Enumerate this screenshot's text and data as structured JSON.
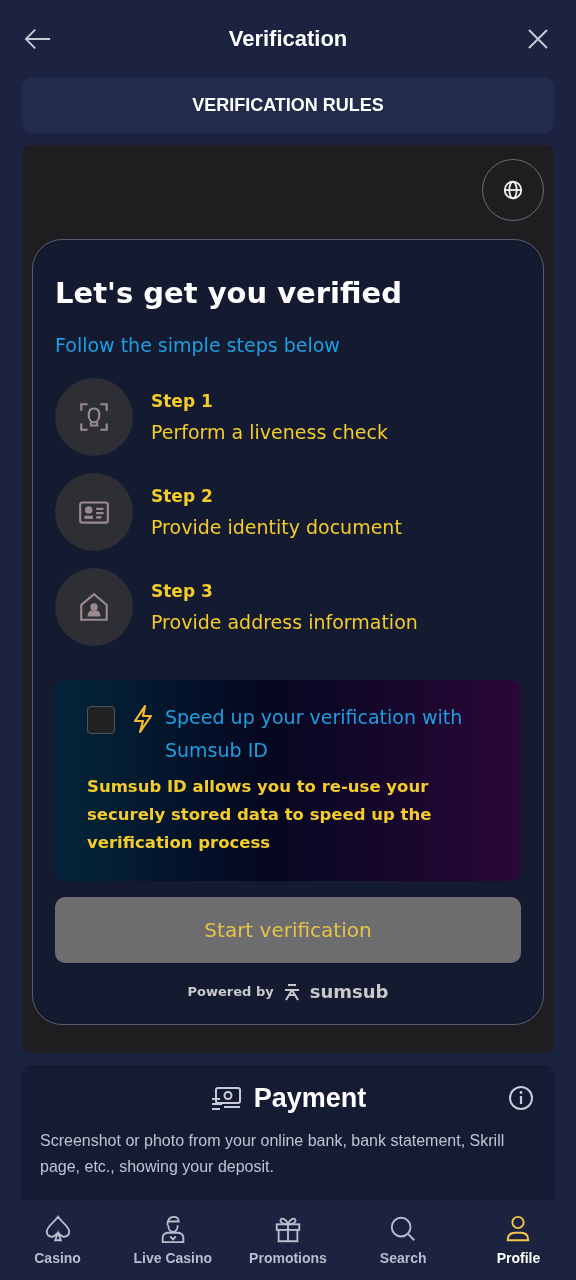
{
  "header": {
    "title": "Verification"
  },
  "rules_button": "VERIFICATION RULES",
  "verify_card": {
    "title": "Let's get you verified",
    "subtitle": "Follow the simple steps below",
    "steps": [
      {
        "kind": "face",
        "label": "Step 1",
        "text": "Perform a liveness check"
      },
      {
        "kind": "id",
        "label": "Step 2",
        "text": "Provide identity document"
      },
      {
        "kind": "home",
        "label": "Step 3",
        "text": "Provide address information"
      }
    ],
    "sumsub_id": {
      "checked": false,
      "title": "Speed up your verification with Sumsub ID",
      "text": "Sumsub ID allows you to re-use your securely stored data to speed up the verification process"
    },
    "start_button": {
      "label": "Start verification",
      "disabled": true
    },
    "powered_by": "Powered by",
    "brand": "sumsub"
  },
  "payment": {
    "title": "Payment",
    "text": "Screenshot or photo from your online bank, bank statement, Skrill page, etc., showing your deposit."
  },
  "nav": [
    {
      "kind": "spade",
      "label": "Casino",
      "selected": false
    },
    {
      "kind": "dealer",
      "label": "Live Casino",
      "selected": false
    },
    {
      "kind": "gift",
      "label": "Promotions",
      "selected": false
    },
    {
      "kind": "search",
      "label": "Search",
      "selected": false
    },
    {
      "kind": "user",
      "label": "Profile",
      "selected": true
    }
  ]
}
